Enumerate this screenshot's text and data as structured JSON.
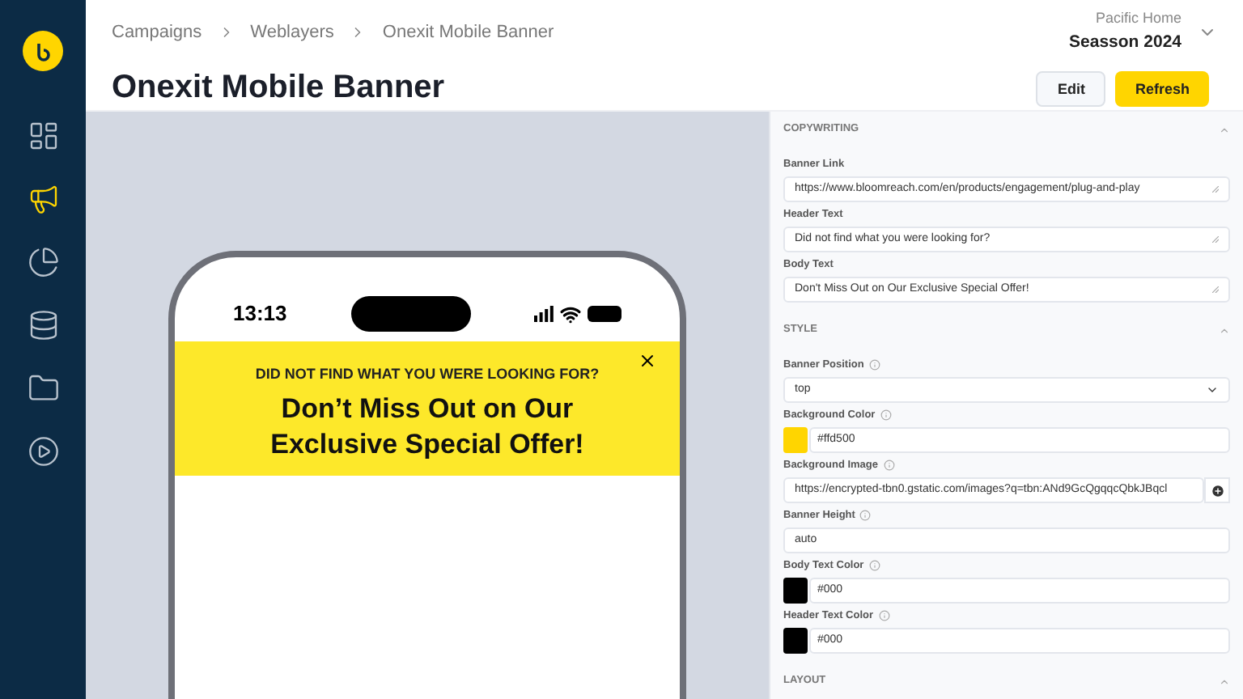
{
  "sidebar": {
    "items": [
      {
        "selected": false
      },
      {
        "selected": true
      },
      {
        "selected": false
      },
      {
        "selected": false
      },
      {
        "selected": false
      },
      {
        "selected": false
      }
    ]
  },
  "breadcrumbs": [
    "Campaigns",
    "Weblayers",
    "Onexit Mobile Banner"
  ],
  "title": "Onexit Mobile Banner",
  "workspace": {
    "project": "Pacific Home",
    "name": "Seasson 2024"
  },
  "buttons": [
    {
      "label": "Edit",
      "kind": "secondary"
    },
    {
      "label": "Refresh",
      "kind": "primary"
    }
  ],
  "preview": {
    "time": "13:13",
    "banner": {
      "header": "DID NOT FIND WHAT YOU WERE LOOKING FOR?",
      "body": "Don’t Miss Out on Our Exclusive Special Offer!"
    }
  },
  "sections": [
    {
      "title": "COPYWRITING",
      "expanded": true,
      "fields": [
        {
          "label": "Banner Link",
          "kind": "textarea",
          "info": false,
          "value": "https://www.bloomreach.com/en/products/engagement/plug-and-play"
        },
        {
          "label": "Header Text",
          "kind": "textarea",
          "info": false,
          "value": "Did not find what you were looking for?"
        },
        {
          "label": "Body Text",
          "kind": "textarea",
          "info": false,
          "value": "Don't Miss Out on Our Exclusive Special Offer!"
        }
      ]
    },
    {
      "title": "STYLE",
      "expanded": true,
      "fields": [
        {
          "label": "Banner Position",
          "kind": "select",
          "info": true,
          "value": "top"
        },
        {
          "label": "Background Color",
          "kind": "color",
          "info": true,
          "value": "#ffd500",
          "color": "#ffd500"
        },
        {
          "label": "Background Image",
          "kind": "image",
          "info": true,
          "value": "https://encrypted-tbn0.gstatic.com/images?q=tbn:ANd9GcQgqqcQbkJBqcl"
        },
        {
          "label": "Banner Height",
          "kind": "text",
          "info": true,
          "value": "auto"
        },
        {
          "label": "Body Text Color",
          "kind": "color",
          "info": true,
          "value": "#000",
          "color": "#000000"
        },
        {
          "label": "Header Text Color",
          "kind": "color",
          "info": true,
          "value": "#000",
          "color": "#000000"
        }
      ]
    },
    {
      "title": "LAYOUT",
      "expanded": true
    }
  ]
}
